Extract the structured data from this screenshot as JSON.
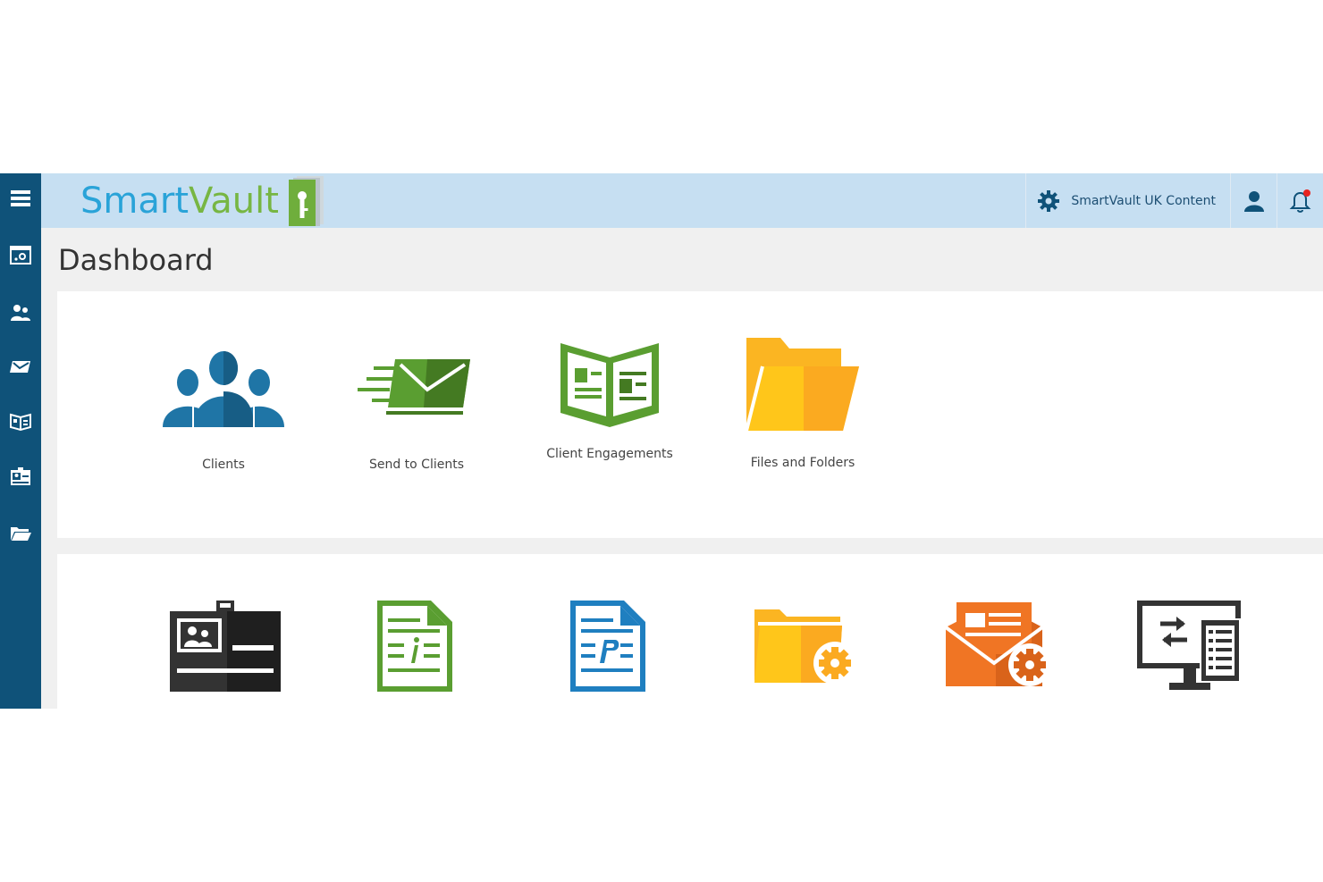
{
  "header": {
    "logo_smart": "Smart",
    "logo_vault": "Vault",
    "settings_label": "SmartVault UK Content"
  },
  "page": {
    "title": "Dashboard"
  },
  "tiles": [
    {
      "label": "Clients"
    },
    {
      "label": "Send to Clients"
    },
    {
      "label": "Client Engagements"
    },
    {
      "label": "Files and Folders"
    }
  ],
  "sidebar": {
    "icons": [
      "menu-icon",
      "dashboard-icon",
      "clients-icon",
      "send-icon",
      "engagements-icon",
      "contacts-icon",
      "folder-icon"
    ]
  },
  "colors": {
    "sidebar": "#0f5279",
    "topbar": "#c6dff2",
    "clients_blue": "#1f75a6",
    "green": "#5a9e31",
    "folder_yellow": "#fbb522",
    "orange": "#f07524",
    "dark_gray": "#333333"
  }
}
